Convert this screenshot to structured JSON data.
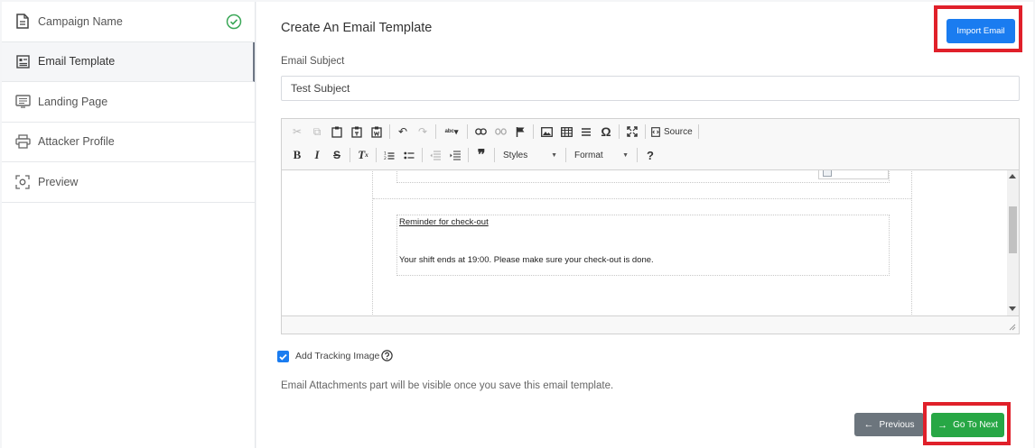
{
  "sidebar": {
    "items": [
      {
        "label": "Campaign Name",
        "icon": "document-icon",
        "completed": true
      },
      {
        "label": "Email Template",
        "icon": "template-icon",
        "active": true
      },
      {
        "label": "Landing Page",
        "icon": "landing-page-icon"
      },
      {
        "label": "Attacker Profile",
        "icon": "printer-icon"
      },
      {
        "label": "Preview",
        "icon": "preview-icon"
      }
    ]
  },
  "main": {
    "title": "Create An Email Template",
    "import_button": "Import Email",
    "subject_label": "Email Subject",
    "subject_value": "Test Subject"
  },
  "editor": {
    "toolbar": {
      "source_label": "Source",
      "styles_label": "Styles",
      "format_label": "Format",
      "help_label": "?"
    },
    "content": {
      "reminder_title": "Reminder for check-out",
      "reminder_text": "Your shift ends at 19:00. Please make sure your check-out is done."
    }
  },
  "tracking": {
    "label": "Add Tracking Image",
    "checked": true
  },
  "attachments_note": "Email Attachments part will be visible once you save this email template.",
  "footer": {
    "previous_label": "Previous",
    "next_label": "Go To Next"
  },
  "colors": {
    "primary": "#1a7cf0",
    "success": "#27a745",
    "secondary": "#6c757d",
    "highlight": "#e0202a",
    "check_green": "#3aa757"
  }
}
